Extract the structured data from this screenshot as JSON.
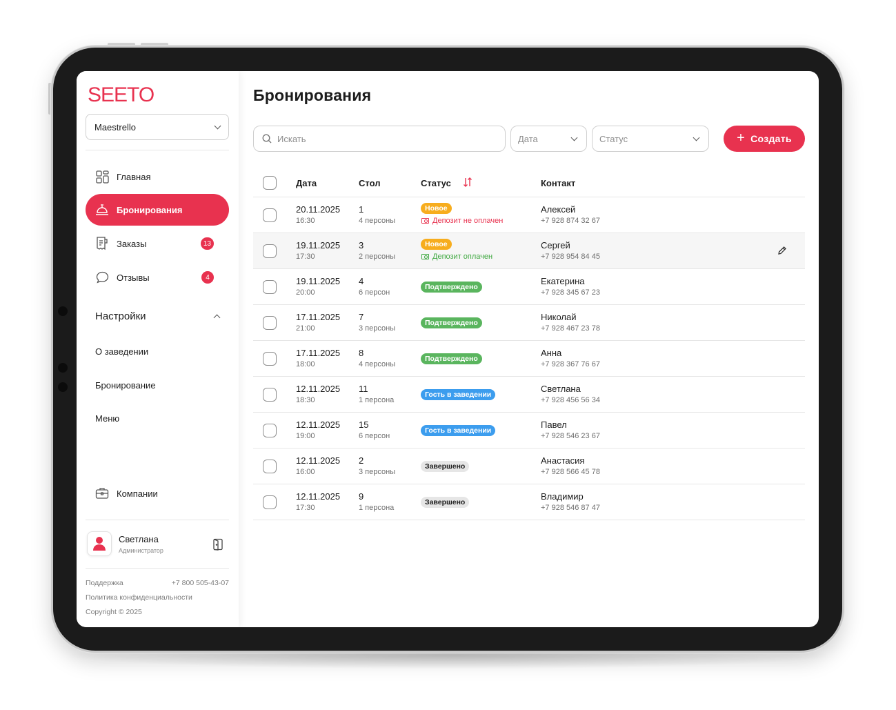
{
  "colors": {
    "accent": "#e8324f",
    "new": "#f7ad1e",
    "confirmed": "#5ab55e",
    "in_venue": "#3c9dee",
    "done": "#e6e6e6",
    "paid": "#3ea83f"
  },
  "sidebar": {
    "logo": "SEETO",
    "venue": "Maestrello",
    "nav": [
      {
        "label": "Главная",
        "icon": "dashboard-grid-icon"
      },
      {
        "label": "Бронирования",
        "icon": "service-bell-icon",
        "active": true
      },
      {
        "label": "Заказы",
        "icon": "receipt-icon",
        "badge": "13"
      },
      {
        "label": "Отзывы",
        "icon": "chat-bubble-icon",
        "badge": "4"
      }
    ],
    "settings": {
      "title": "Настройки",
      "items": [
        "О заведении",
        "Бронирование",
        "Меню"
      ]
    },
    "companies": "Компании",
    "user": {
      "name": "Светлана",
      "role": "Администратор"
    },
    "footer": {
      "support": "Поддержка",
      "phone": "+7 800 505-43-07",
      "privacy": "Политика конфиденциальности",
      "copyright": "Copyright © 2025"
    }
  },
  "main": {
    "title": "Бронирования",
    "search_placeholder": "Искать",
    "filter_date": "Дата",
    "filter_status": "Статус",
    "create": "Создать",
    "columns": {
      "date": "Дата",
      "table": "Стол",
      "status": "Статус",
      "contact": "Контакт"
    },
    "rows": [
      {
        "date": "20.11.2025",
        "time": "16:30",
        "table": "1",
        "guests": "4 персоны",
        "status": "Новое",
        "status_type": "new",
        "deposit": "Депозит не оплачен",
        "deposit_type": "unpaid",
        "name": "Алексей",
        "phone": "+7 928 874 32 67"
      },
      {
        "date": "19.11.2025",
        "time": "17:30",
        "table": "3",
        "guests": "2 персоны",
        "status": "Новое",
        "status_type": "new",
        "deposit": "Депозит оплачен",
        "deposit_type": "paid",
        "name": "Сергей",
        "phone": "+7 928 954 84 45",
        "hover": true
      },
      {
        "date": "19.11.2025",
        "time": "20:00",
        "table": "4",
        "guests": "6 персон",
        "status": "Подтверждено",
        "status_type": "confirmed",
        "name": "Екатерина",
        "phone": "+7 928 345 67 23"
      },
      {
        "date": "17.11.2025",
        "time": "21:00",
        "table": "7",
        "guests": "3 персоны",
        "status": "Подтверждено",
        "status_type": "confirmed",
        "name": "Николай",
        "phone": "+7 928 467 23 78"
      },
      {
        "date": "17.11.2025",
        "time": "18:00",
        "table": "8",
        "guests": "4 персоны",
        "status": "Подтверждено",
        "status_type": "confirmed",
        "name": "Анна",
        "phone": "+7 928 367 76 67"
      },
      {
        "date": "12.11.2025",
        "time": "18:30",
        "table": "11",
        "guests": "1 персона",
        "status": "Гость в заведении",
        "status_type": "in_venue",
        "name": "Светлана",
        "phone": "+7 928 456 56 34"
      },
      {
        "date": "12.11.2025",
        "time": "19:00",
        "table": "15",
        "guests": "6 персон",
        "status": "Гость в заведении",
        "status_type": "in_venue",
        "name": "Павел",
        "phone": "+7 928 546 23 67"
      },
      {
        "date": "12.11.2025",
        "time": "16:00",
        "table": "2",
        "guests": "3 персоны",
        "status": "Завершено",
        "status_type": "done",
        "name": "Анастасия",
        "phone": "+7 928 566 45 78"
      },
      {
        "date": "12.11.2025",
        "time": "17:30",
        "table": "9",
        "guests": "1 персона",
        "status": "Завершено",
        "status_type": "done",
        "name": "Владимир",
        "phone": "+7 928 546 87 47"
      }
    ]
  }
}
